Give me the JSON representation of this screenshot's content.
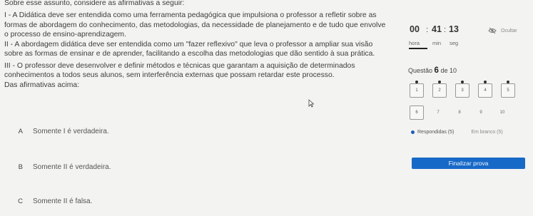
{
  "question": {
    "header_line": "Sobre esse assunto, considere as afirmativas a seguir:",
    "statements": [
      "I - A Didática deve ser entendida como uma ferramenta pedagógica que impulsiona o professor a refletir sobre as formas de abordagem do conhecimento, das metodologias, da necessidade de planejamento e de tudo que envolve o processo de ensino-aprendizagem.",
      "II - A abordagem didática deve ser entendida como um \"fazer reflexivo\" que leva o professor a ampliar sua visão sobre as formas de ensinar e de aprender, facilitando a escolha das metodologias que dão sentido à sua prática.",
      "III - O professor deve desenvolver e definir métodos e técnicas que garantam a aquisição de determinados conhecimentos a todos seus alunos, sem interferência externas que possam retardar este processo."
    ],
    "prompt": "Das afirmativas acima:"
  },
  "options": [
    {
      "letter": "A",
      "text": "Somente I é verdadeira."
    },
    {
      "letter": "B",
      "text": "Somente II é verdadeira."
    },
    {
      "letter": "C",
      "text": "Somente II é falsa."
    }
  ],
  "timer": {
    "hours": "00",
    "minutes": "41",
    "seconds": "13",
    "hours_label": "hora",
    "minutes_label": "min",
    "seconds_label": "seg",
    "separator": ":"
  },
  "hide_label": "Ocultar",
  "question_counter": {
    "prefix": "Questão",
    "current": "6",
    "of_text": "de 10"
  },
  "nav": [
    {
      "n": "1",
      "answered": true
    },
    {
      "n": "2",
      "answered": true
    },
    {
      "n": "3",
      "answered": true
    },
    {
      "n": "4",
      "answered": true
    },
    {
      "n": "5",
      "answered": true
    },
    {
      "n": "6",
      "answered": false,
      "current": true
    },
    {
      "n": "7",
      "answered": false
    },
    {
      "n": "8",
      "answered": false
    },
    {
      "n": "9",
      "answered": false
    },
    {
      "n": "10",
      "answered": false
    }
  ],
  "legend": {
    "answered": "Respondidas (5)",
    "blank": "Em branco (5)"
  },
  "finalize_label": "Finalizar prova",
  "colors": {
    "accent": "#1769c7",
    "legend_dot": "#1b5bbf",
    "background": "#f3f3f1"
  }
}
